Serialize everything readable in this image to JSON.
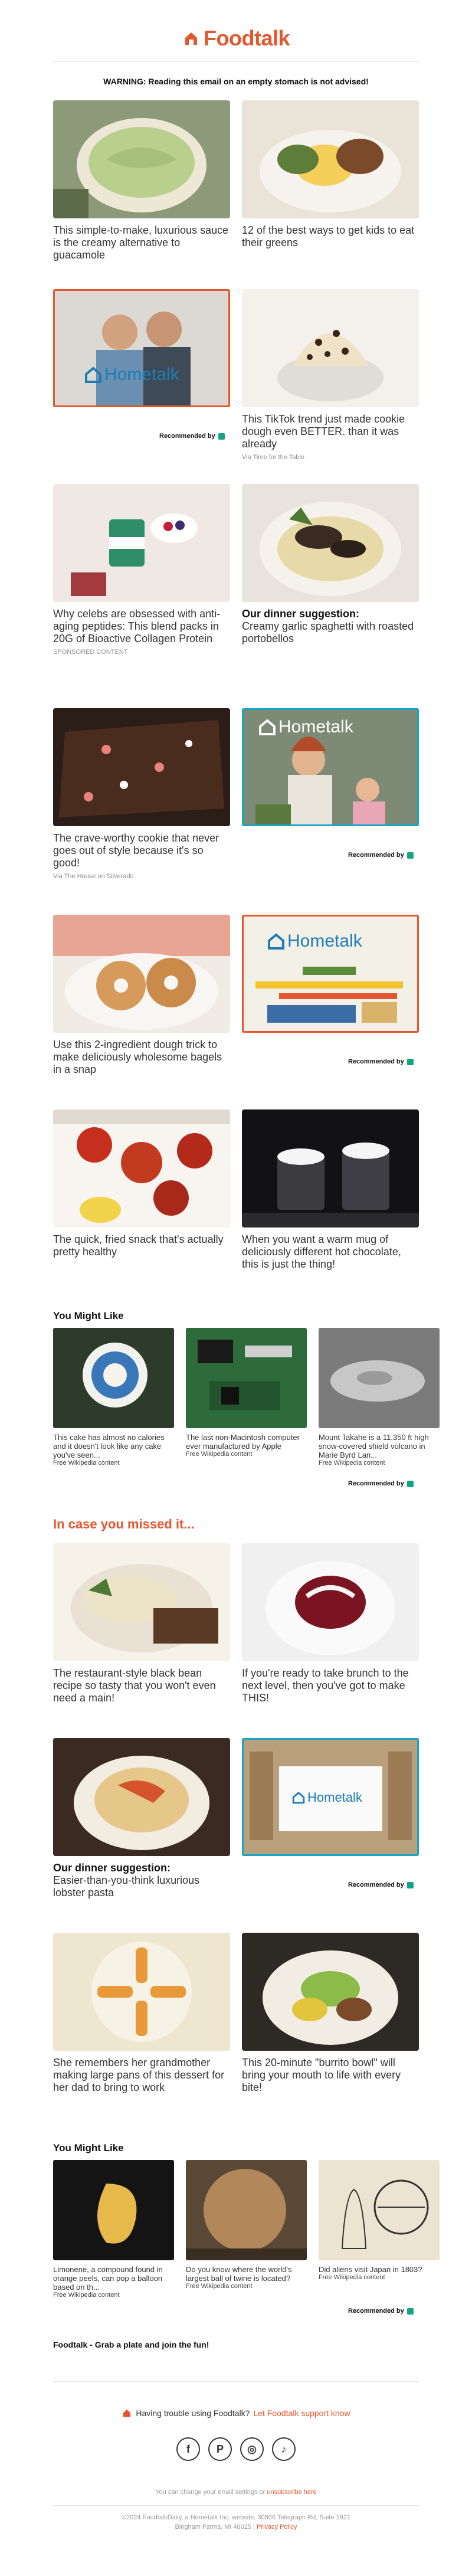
{
  "brand": {
    "name": "Foodtalk",
    "accent": "#e4572e"
  },
  "warning": "WARNING: Reading this email on an empty stomach is not advised!",
  "articles": [
    {
      "title": "This simple-to-make, luxurious sauce is the creamy alternative to guacamole",
      "source": ""
    },
    {
      "title": "12 of the best ways to get kids to eat their greens",
      "source": ""
    },
    {
      "title": "",
      "source": ""
    },
    {
      "title": "This TikTok trend just made cookie dough even BETTER. than it was already",
      "source": "Via Time for the Table"
    },
    {
      "title": "Why celebs are obsessed with anti-aging peptides: This blend packs in 20G of Bioactive Collagen Protein",
      "source": "SPONSORED CONTENT"
    },
    {
      "kicker": "Our dinner suggestion:",
      "title": "Creamy garlic spaghetti with roasted portobellos",
      "source": ""
    },
    {
      "title": "The crave-worthy cookie that never goes out of style because it's so good!",
      "source": "Via The House on Silverado"
    },
    {
      "title": "",
      "source": ""
    },
    {
      "title": "Use this 2-ingredient dough trick to make deliciously wholesome bagels in a snap",
      "source": ""
    },
    {
      "title": "",
      "source": ""
    },
    {
      "title": "The quick, fried snack that's actually pretty healthy",
      "source": ""
    },
    {
      "title": "When you want a warm mug of deliciously different hot chocolate, this is just the thing!",
      "source": ""
    },
    {
      "title": "The restaurant-style black bean recipe so tasty that you won't even need a main!",
      "source": ""
    },
    {
      "title": "If you're ready to take brunch to the next level, then you've got to make THIS!",
      "source": ""
    },
    {
      "kicker": "Our dinner suggestion:",
      "title": "Easier-than-you-think luxurious lobster pasta",
      "source": ""
    },
    {
      "title": "",
      "source": ""
    },
    {
      "title": "She remembers her grandmother making large pans of this dessert for her dad to bring to work",
      "source": ""
    },
    {
      "title": "This 20-minute \"burrito bowl\" will bring your mouth to life with every bite!",
      "source": ""
    }
  ],
  "ad_brand": "Hometalk",
  "recommended": "Recommended by",
  "you_might_like": "You Might Like",
  "in_case_missed": "In case you missed it...",
  "wiki_1": [
    {
      "title": "This cake has almost no calories and it doesn't look like any cake you've seen...",
      "source": "Free Wikipedia content"
    },
    {
      "title": "The last non-Macintosh computer ever manufactured by Apple",
      "source": "Free Wikipedia content"
    },
    {
      "title": "Mount Takahe is a 11,350 ft high snow-covered shield volcano in Marie Byrd Lan...",
      "source": "Free Wikipedia content"
    }
  ],
  "wiki_2": [
    {
      "title": "Limonene, a compound found in orange peels, can pop a balloon based on th...",
      "source": "Free Wikipedia content"
    },
    {
      "title": "Do you know where the world's largest ball of twine is located?",
      "source": "Free Wikipedia content"
    },
    {
      "title": "Did aliens visit Japan in 1803?",
      "source": "Free Wikipedia content"
    }
  ],
  "signoff": "Foodtalk - Grab a plate and join the fun!",
  "trouble": {
    "text": "Having trouble using Foodtalk?",
    "link": "Let Foodtalk support know"
  },
  "social": [
    "f",
    "P",
    "◎",
    "♪"
  ],
  "footer": {
    "prefs_text": "You can change your email settings or",
    "prefs_link": "unsubscribe here",
    "address": "©2024 FoodtalkDaily, a Hometalk Inc. website, 30800 Telegraph Rd, Suite 1921",
    "city": "Bingham Farms, MI 48025",
    "privacy": "Privacy Policy"
  }
}
